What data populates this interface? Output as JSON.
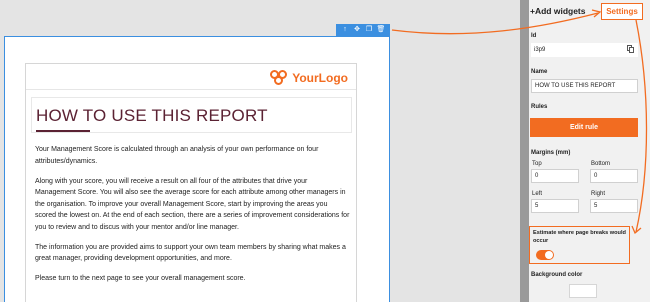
{
  "colors": {
    "accent": "#f26c21",
    "selection": "#3b8fe0",
    "title": "#5b2233"
  },
  "toolbar": {
    "icons": [
      "arrow-up-icon",
      "move-icon",
      "copy-icon",
      "delete-icon"
    ],
    "glyphs": [
      "↑",
      "✥",
      "❐",
      "🗑"
    ]
  },
  "document": {
    "logo_text": "YourLogo",
    "title": "HOW TO USE THIS REPORT",
    "paragraphs": [
      "Your Management Score is calculated through an analysis of your own performance on four attributes/dynamics.",
      "Along with your score, you will receive a result on all four of the attributes that drive your Management Score. You will also see the average score for each attribute among other managers in the organisation. To improve your overall Management Score, start by improving the areas you scored the lowest on. At the end of each section, there are a series of improvement considerations for you to review and to discus with your mentor and/or line manager.",
      "The information you are provided aims to support your own team members by sharing what makes a great manager, providing development opportunities, and more.",
      "Please turn to the next page to see your overall management score."
    ]
  },
  "panel": {
    "add_widgets": "+Add widgets",
    "settings_tab": "Settings",
    "id_label": "Id",
    "id_value": "i3p9",
    "name_label": "Name",
    "name_value": "HOW TO USE THIS REPORT",
    "rules_label": "Rules",
    "edit_rule_button": "Edit rule",
    "margins_label": "Margins (mm)",
    "top_label": "Top",
    "top_value": "0",
    "bottom_label": "Bottom",
    "bottom_value": "0",
    "left_label": "Left",
    "left_value": "5",
    "right_label": "Right",
    "right_value": "5",
    "estimate_label": "Estimate where page breaks would occur",
    "estimate_enabled": true,
    "background_color_label": "Background color"
  }
}
